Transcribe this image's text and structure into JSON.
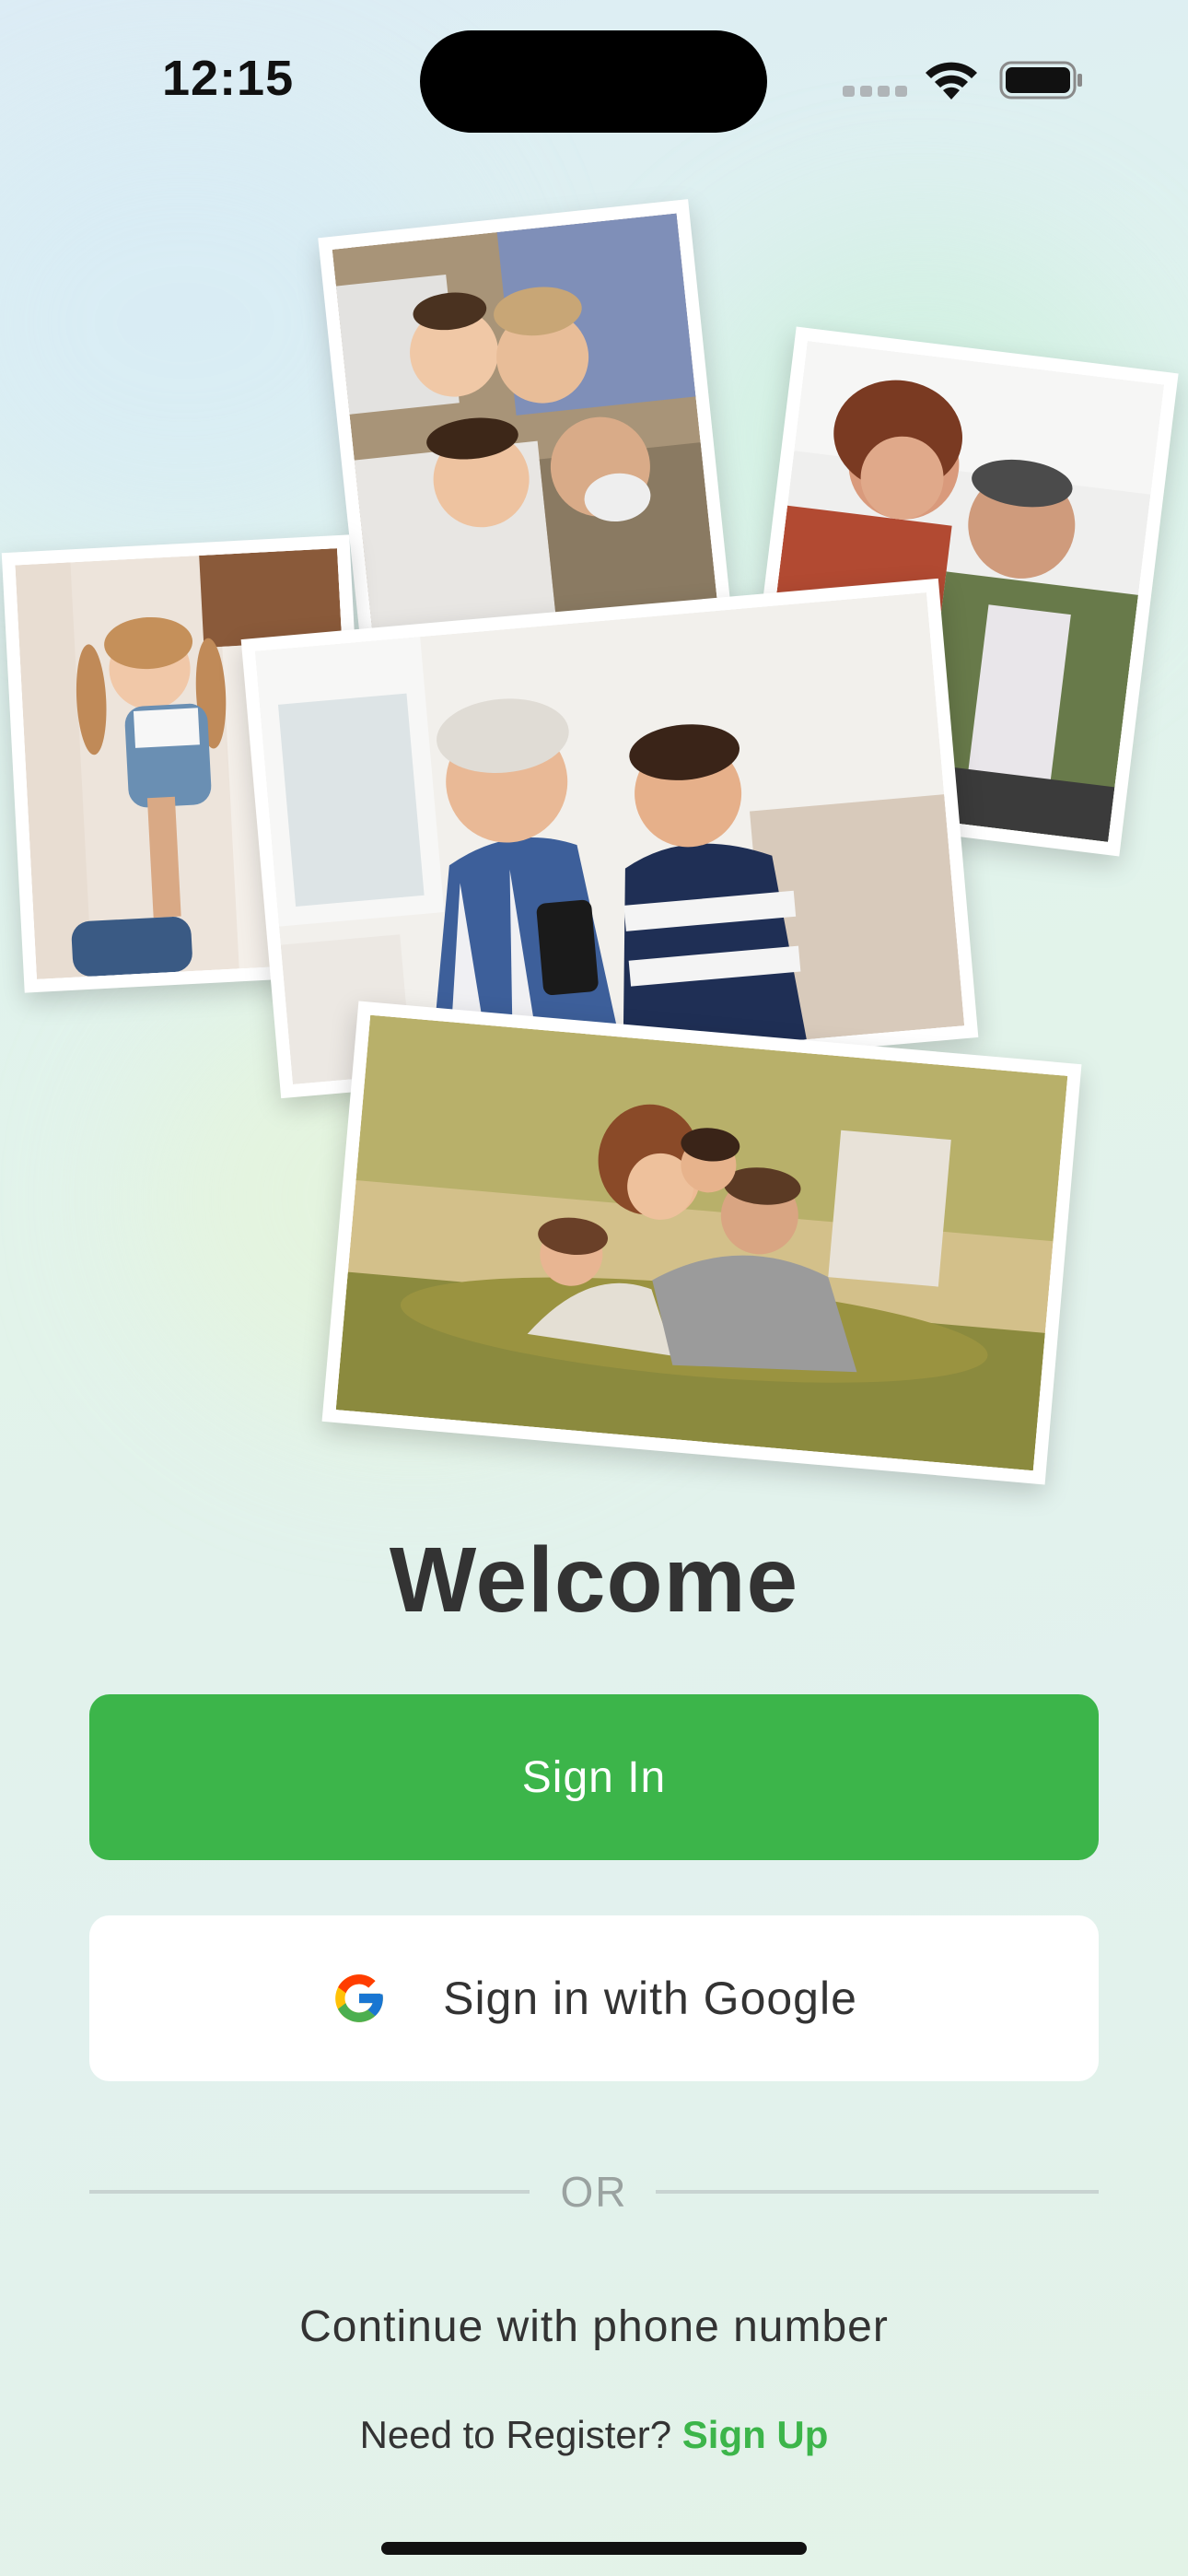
{
  "status_bar": {
    "time": "12:15",
    "signal_icon": "cellular-signal-icon",
    "wifi_icon": "wifi-icon",
    "battery_icon": "battery-icon"
  },
  "photos": [
    {
      "name": "photo-family-circle",
      "icon": "family-lying-in-circle-photo"
    },
    {
      "name": "photo-couple",
      "icon": "couple-embracing-photo"
    },
    {
      "name": "photo-girl-playing",
      "icon": "girl-playing-photo"
    },
    {
      "name": "photo-grandmother-grandson",
      "icon": "grandmother-and-grandson-photo"
    },
    {
      "name": "photo-family-grass",
      "icon": "family-on-grass-photo"
    }
  ],
  "welcome": {
    "title": "Welcome"
  },
  "buttons": {
    "sign_in": "Sign In",
    "google": "Sign in with Google",
    "google_icon": "google-g-icon"
  },
  "divider": {
    "or_text": "OR"
  },
  "phone": {
    "label": "Continue with phone number"
  },
  "register": {
    "prompt": "Need to Register?",
    "link": "Sign Up"
  },
  "colors": {
    "accent_green": "#3cb54a",
    "text_dark": "#333333",
    "divider": "#c8d3d1",
    "or_gray": "#9aa2a0"
  }
}
